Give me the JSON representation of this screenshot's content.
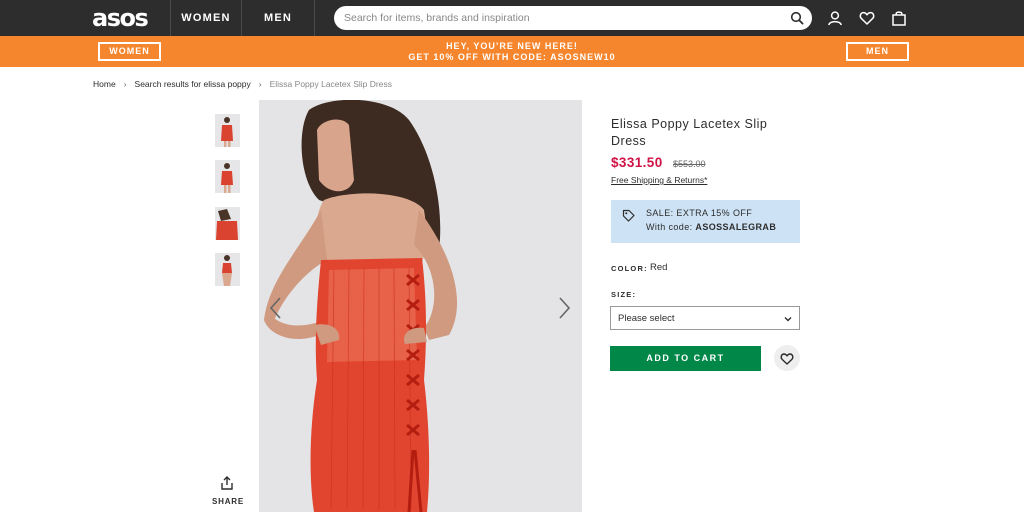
{
  "header": {
    "logo": "asos",
    "nav": [
      "WOMEN",
      "MEN"
    ],
    "search_placeholder": "Search for items, brands and inspiration",
    "icons": [
      "search-icon",
      "account-icon",
      "heart-icon",
      "bag-icon"
    ]
  },
  "promo": {
    "left_button": "WOMEN",
    "line1": "HEY, YOU’RE NEW HERE!",
    "line2": "GET 10% OFF WITH CODE: ASOSNEW10",
    "right_button": "MEN",
    "color": "#f6862d"
  },
  "breadcrumb": {
    "home": "Home",
    "sep": "›",
    "search": "Search results for elissa poppy",
    "current": "Elissa Poppy Lacetex Slip Dress"
  },
  "gallery": {
    "thumb_count": 4,
    "share_label": "SHARE"
  },
  "product": {
    "name": "Elissa Poppy Lacetex Slip Dress",
    "price": "$331.50",
    "old_price": "$553.00",
    "shipping": "Free Shipping & Returns*",
    "sale_line1": "SALE: EXTRA 15% OFF",
    "sale_prefix": "With code: ",
    "sale_code": "ASOSSALEGRAB",
    "color_label": "COLOR:",
    "color_value": "Red",
    "size_label": "SIZE:",
    "size_placeholder": "Please select",
    "add_to_cart": "ADD TO CART",
    "price_color": "#d01345",
    "cart_color": "#018849"
  }
}
